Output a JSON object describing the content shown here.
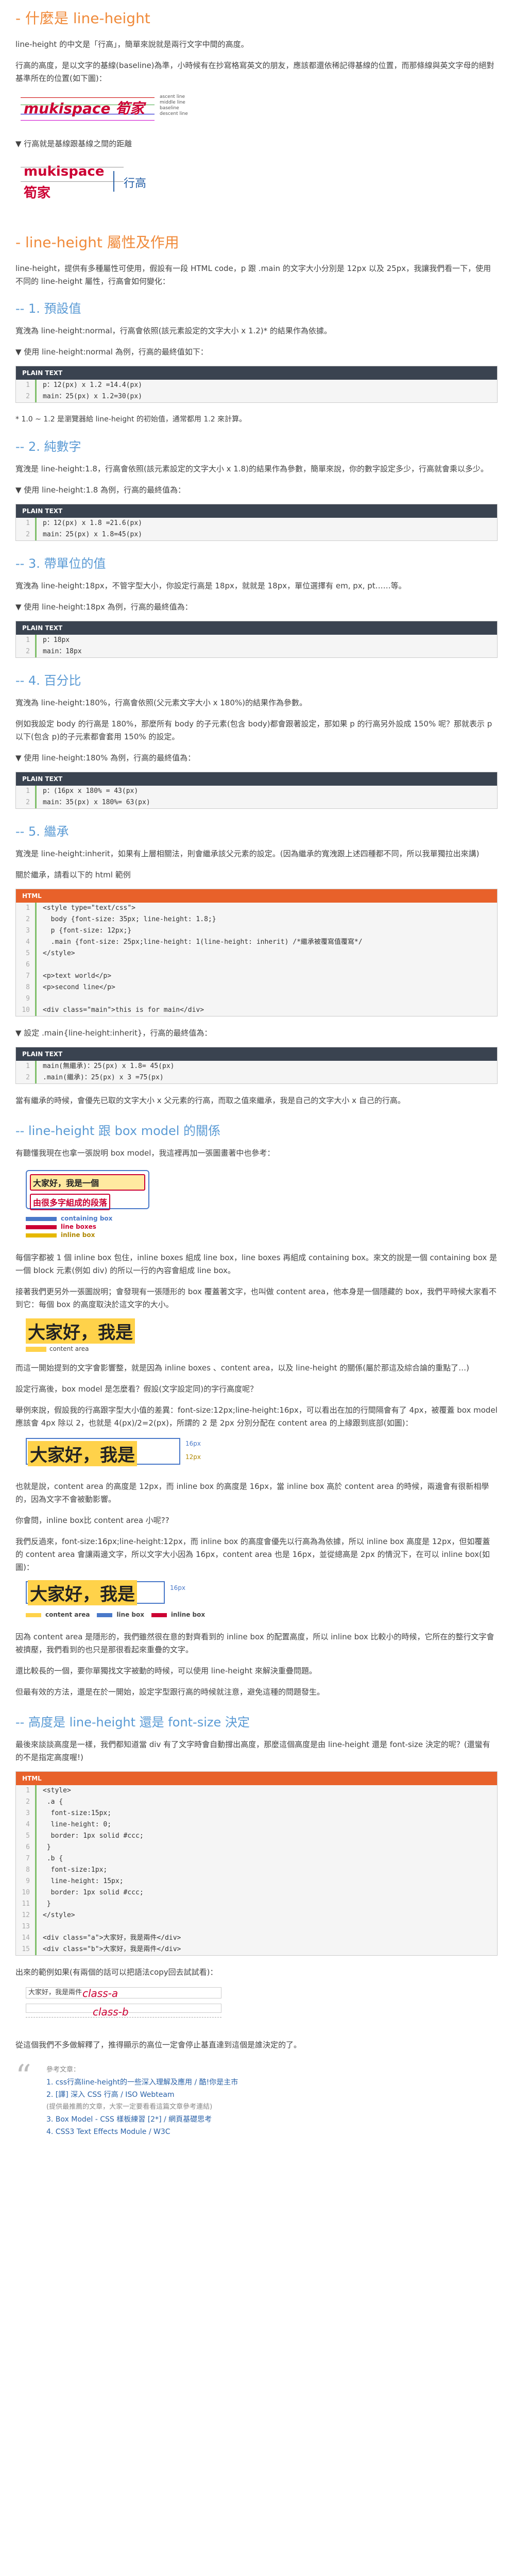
{
  "s1": {
    "h": "- 什麼是 line-height",
    "p1": "line-height 的中文是「行高」，簡單來說就是兩行文字中間的高度。",
    "p2": "行高的高度，是以文字的基線(baseline)為準，小時候有在抄寫格寫英文的朋友，應該都還依稀記得基線的位置，而那條線與英文字母的絕對基準所在的位置(如下圖)：",
    "fig1_text": "mukispace 筍家",
    "fig1_labels": [
      "ascent line",
      "middle line",
      "baseline",
      "descent line"
    ],
    "p3": "▼ 行高就是基線跟基線之間的距離",
    "fig2_a": "mukispace",
    "fig2_b": "筍家",
    "fig2_c": "行高"
  },
  "s2": {
    "h": "- line-height 屬性及作用",
    "p1": "line-height，提供有多種屬性可使用，假設有一段 HTML code，p 跟 .main 的文字大小分別是 12px 以及 25px，我讓我們看一下，使用不同的 line-height 屬性，行高會如何變化：",
    "s_normal": "-- 1. 預設值",
    "n1": "寬洩為 line-height:normal，行高會依照(該元素設定的文字大小 x 1.2)* 的結果作為依據。",
    "n2": "▼ 使用 line-height:normal 為例，行高的最終值如下：",
    "code_bar": "PLAIN TEXT",
    "n_code": [
      "p：12(px) x 1.2 =14.4(px)",
      "main：25(px) x 1.2=30(px)"
    ],
    "n3": "* 1.0 ~ 1.2 是瀏覽器給 line-height 的初始值，通常都用 1.2 來計算。",
    "s_num": "-- 2. 純數字",
    "u1": "寬洩是 line-height:1.8，行高會依照(該元素設定的文字大小 x 1.8)的結果作為參數，簡單來說，你的數字設定多少，行高就會乘以多少。",
    "u2": "▼ 使用 line-height:1.8 為例，行高的最終值為：",
    "u_code": [
      "p：12(px) x 1.8 =21.6(px)",
      "main：25(px) x 1.8=45(px)"
    ],
    "s_unit": "-- 3. 帶單位的值",
    "w1": "寬洩為 line-height:18px，不管字型大小，你設定行高是 18px，就就是 18px，單位選擇有 em, px, pt……等。",
    "w2": "▼ 使用 line-height:18px 為例，行高的最終值為：",
    "w_code": [
      "p：18px",
      "main：18px"
    ],
    "s_pct": "-- 4. 百分比",
    "x1": "寬洩為 line-height:180%，行高會依照(父元素文字大小 x 180%)的結果作為參數。",
    "x2": "例如我設定 body 的行高是 180%，那麼所有 body 的子元素(包含 body)都會跟著設定，那如果 p 的行高另外設成 150% 呢？那就表示 p 以下(包含 p)的子元素都會套用 150% 的設定。",
    "x3": "▼ 使用 line-height:180% 為例，行高的最終值為：",
    "x_code": [
      "p：(16px x 180% = 43(px)",
      "main：35(px) x 180%= 63(px)"
    ],
    "s_inh": "-- 5. 繼承",
    "y1": "寬洩是 line-height:inherit，如果有上層相關法，則會繼承該父元素的設定。(因為繼承的寬洩跟上述四種都不同，所以我單獨拉出來講)",
    "y2": "關於繼承，請看以下的 html 範例",
    "html_bar": "HTML",
    "y_code": [
      "<style type=\"text/css\">",
      "  body {font-size: 35px; line-height: 1.8;}",
      "  p {font-size: 12px;}",
      "  .main {font-size: 25px;line-height: 1(line-height: inherit) /*繼承被覆寫值覆寫*/",
      "</style>",
      "",
      "<p>text world</p>",
      "<p>second line</p>",
      "",
      "<div class=\"main\">this is for main</div>"
    ],
    "y3": "▼ 設定 .main{line-height:inherit}，行高的最終值為：",
    "y_code2": [
      "main(無繼承)：25(px) x 1.8= 45(px)",
      ".main(繼承)：25(px) x 3 =75(px)"
    ],
    "y4": "當有繼承的時候，會優先已取的文字大小 x 父元素的行高，而取之值來繼承，我是自己的文字大小 x 自己的行高。"
  },
  "s3": {
    "h": "-- line-height 跟 box model 的關係",
    "p1": "有聽懂我現在也拿一張說明 box model，我這裡再加一張圖畫著中也參考：",
    "fig_a": "大家好，我是一個",
    "fig_b": "由很多字組成的段落",
    "legend": [
      "containing box",
      "line boxes",
      "inline box"
    ],
    "p2": "每個字都被 1 個 inline box 包住，inline boxes 組成 line box，line boxes 再組成 containing box。來文的說是一個 containing box 是一個 block 元素(例如 div) 的所以一行的內容會組成 line box。",
    "p3": "接著我們更另外一張圖說明；會發現有一張隱形的 box 覆蓋著文字，也叫做 content area，他本身是一個隱藏的 box，我們平時候大家看不到它：每個 box 的高度取決於這文字的大小。",
    "fig_c": "大家好，我是",
    "fig_c_l": "content area",
    "p4": "而這一開始提到的文字會影響整，就是因為 inline boxes 、content area，以及 line-height 的關係(屬於那這及綜合論的重點了…)",
    "p5": "設定行高後，box model 是怎麼看？假設(文字設定同)的字行高度呢？",
    "p6": "舉例來說，假設我的行高跟字型大小值的差異：font-size:12px;line-height:16px，可以看出在加的行間隔會有了 4px，被覆蓋 box model 應該會 4px 除以 2，也就是 4(px)/2=2(px)，所謂的 2 是 2px 分別分配在 content area 的上緣跟到底部(如圖)：",
    "fig_d": "大家好，我是",
    "fig_d_r": "16px",
    "fig_d_l": "12px",
    "p7": "也就是說，content area 的高度是 12px，而 inline box 的高度是 16px，當 inline box 高於 content area 的時候，兩邊會有很新相學的，因為文字不會被動影響。",
    "p8": "你會問，inline box比 content area 小呢??",
    "p9": "我們反過來，font-size:16px;line-height:12px，而 inline box 的高度會優先以行高為為依據，所以 inline box 高度是 12px，但如覆蓋的 content area 會讓兩邊文字，所以文字大小因為 16px，content area 也是 16px，並從總高是 2px 的情況下，在可以 inline box(如圖)：",
    "fig_e": "大家好，我是",
    "fig_e_r": "16px",
    "fig_e_legend": [
      "content area",
      "line box",
      "inline box"
    ],
    "p10": "因為 content area 是隱形的，我們雖然很在意的對齊看到的 inline box 的配置高度，所以 inline box 比較小的時候，它所在的整行文字會被擠壓，我們看到的也只是那很看起來重疊的文字。",
    "p11": "還比較長的一個，要你單獨找文字被動的時候，可以使用 line-height 來解決重疊問題。",
    "p12": "但最有效的方法，還是在於一開始，設定字型跟行高的時候就注意，避免這種的問題發生。"
  },
  "s4": {
    "h": "-- 高度是 line-height 還是 font-size 決定",
    "p1": "最後來談談高度是一樣，我們都知道當 div 有了文字時會自動撐出高度，那麼這個高度是由 line-height 還是 font-size 決定的呢？(還蠻有的不是指定高度喔!)",
    "code": [
      "<style>",
      " .a {",
      "  font-size:15px;",
      "  line-height: 0;",
      "  border: 1px solid #ccc;",
      " }",
      " .b {",
      "  font-size:1px;",
      "  line-height: 15px;",
      "  border: 1px solid #ccc;",
      " }",
      "</style>",
      "",
      "<div class=\"a\">大家好，我是兩件</div>",
      "<div class=\"b\">大家好，我是兩件</div>"
    ],
    "p2": "出來的範例如果(有兩個的話可以把語法copy回去試試看)：",
    "fig_a": "大家好，我是兩件",
    "fig_a_l": "class-a",
    "fig_b_l": "class-b",
    "p3": "從這個我們不多做解釋了，推得顯示的高位一定會停止基直達到這個是誰決定的了。"
  },
  "refs": {
    "title": "參考文章：",
    "items": [
      "1. css行高line-height的一些深入理解及應用 / 酷!你是主市",
      "2. [譯] 深入 CSS 行高 / ISO Webteam",
      "(提供最推薦的文章，大家一定要看看這篇文章參考連結)",
      "3. Box Model - CSS 樣板練習 [2*] / 網頁基礎思考",
      "4. CSS3 Text Effects Module / W3C"
    ]
  }
}
